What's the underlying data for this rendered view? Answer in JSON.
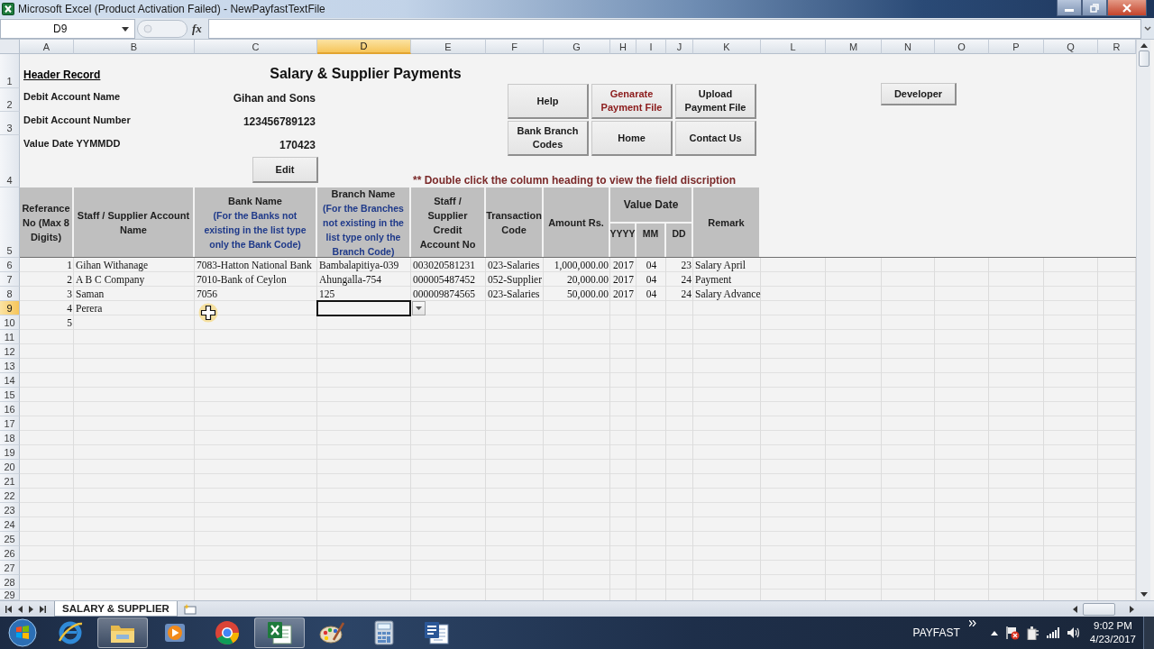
{
  "window": {
    "title": "Microsoft Excel (Product Activation Failed) - NewPayfastTextFile"
  },
  "formula_bar": {
    "name_box": "D9",
    "function_label": "fx"
  },
  "columns": [
    {
      "label": "A",
      "selected": false
    },
    {
      "label": "B",
      "selected": false
    },
    {
      "label": "C",
      "selected": false
    },
    {
      "label": "D",
      "selected": true
    },
    {
      "label": "E",
      "selected": false
    },
    {
      "label": "F",
      "selected": false
    },
    {
      "label": "G",
      "selected": false
    },
    {
      "label": "H",
      "selected": false
    },
    {
      "label": "I",
      "selected": false
    },
    {
      "label": "J",
      "selected": false
    },
    {
      "label": "K",
      "selected": false
    },
    {
      "label": "L",
      "selected": false
    },
    {
      "label": "M",
      "selected": false
    },
    {
      "label": "N",
      "selected": false
    },
    {
      "label": "O",
      "selected": false
    },
    {
      "label": "P",
      "selected": false
    },
    {
      "label": "Q",
      "selected": false
    },
    {
      "label": "R",
      "selected": false
    }
  ],
  "rows": [
    {
      "label": "1",
      "selected": false
    },
    {
      "label": "2",
      "selected": false
    },
    {
      "label": "3",
      "selected": false
    },
    {
      "label": "4",
      "selected": false
    },
    {
      "label": "5",
      "selected": false
    },
    {
      "label": "6",
      "selected": false
    },
    {
      "label": "7",
      "selected": false
    },
    {
      "label": "8",
      "selected": false
    },
    {
      "label": "9",
      "selected": true
    },
    {
      "label": "10",
      "selected": false
    },
    {
      "label": "11",
      "selected": false
    },
    {
      "label": "12",
      "selected": false
    },
    {
      "label": "13",
      "selected": false
    },
    {
      "label": "14",
      "selected": false
    },
    {
      "label": "15",
      "selected": false
    },
    {
      "label": "16",
      "selected": false
    },
    {
      "label": "17",
      "selected": false
    },
    {
      "label": "18",
      "selected": false
    },
    {
      "label": "19",
      "selected": false
    },
    {
      "label": "20",
      "selected": false
    },
    {
      "label": "21",
      "selected": false
    },
    {
      "label": "22",
      "selected": false
    },
    {
      "label": "23",
      "selected": false
    },
    {
      "label": "24",
      "selected": false
    },
    {
      "label": "25",
      "selected": false
    },
    {
      "label": "26",
      "selected": false
    },
    {
      "label": "27",
      "selected": false
    },
    {
      "label": "28",
      "selected": false
    },
    {
      "label": "29",
      "selected": false
    }
  ],
  "header_record": {
    "title": "Header Record",
    "fields": [
      {
        "label": "Debit Account Name",
        "value": "Gihan and Sons"
      },
      {
        "label": "Debit Account Number",
        "value": "123456789123"
      },
      {
        "label": "Value Date YYMMDD",
        "value": "170423"
      }
    ],
    "edit_button": "Edit"
  },
  "sheet_title": "Salary & Supplier Payments",
  "buttons": [
    {
      "label": "Help",
      "emphasis": false
    },
    {
      "label": "Genarate Payment File",
      "emphasis": true
    },
    {
      "label": "Upload Payment File",
      "emphasis": false
    },
    {
      "label": "Bank Branch Codes",
      "emphasis": false
    },
    {
      "label": "Home",
      "emphasis": false
    },
    {
      "label": "Contact Us",
      "emphasis": false
    }
  ],
  "developer_button": "Developer",
  "note": "** Double click the column heading to view the field discription",
  "table": {
    "columns": [
      {
        "title": "Referance No (Max 8 Digits)"
      },
      {
        "title": "Staff / Supplier Account Name"
      },
      {
        "title": "Bank Name",
        "note": "(For the Banks not existing in the list type only the Bank Code)"
      },
      {
        "title": "Branch Name",
        "note": "(For the Branches not existing in the list type only the Branch Code)"
      },
      {
        "title": "Staff / Supplier Credit Account No"
      },
      {
        "title": "Transaction Code"
      },
      {
        "title": "Amount Rs."
      },
      {
        "title": "Value Date",
        "subcolumns": [
          "YYYY",
          "MM",
          "DD"
        ]
      },
      {
        "title": "Remark"
      }
    ],
    "rows": [
      {
        "ref": "1",
        "name": "Gihan Withanage",
        "bank": "7083-Hatton National Bank",
        "branch": "Bambalapitiya-039",
        "account": "003020581231",
        "transaction": "023-Salaries",
        "amount": "1,000,000.00",
        "yyyy": "2017",
        "mm": "04",
        "dd": "23",
        "remark": "Salary April"
      },
      {
        "ref": "2",
        "name": "A B C Company",
        "bank": "7010-Bank of Ceylon",
        "branch": "Ahungalla-754",
        "account": "000005487452",
        "transaction": "052-Supplier",
        "amount": "20,000.00",
        "yyyy": "2017",
        "mm": "04",
        "dd": "24",
        "remark": "Payment"
      },
      {
        "ref": "3",
        "name": "Saman",
        "bank": "7056",
        "branch": "125",
        "account": "000009874565",
        "transaction": "023-Salaries",
        "amount": "50,000.00",
        "yyyy": "2017",
        "mm": "04",
        "dd": "24",
        "remark": "Salary Advance"
      },
      {
        "ref": "4",
        "name": "Perera"
      },
      {
        "ref": "5"
      }
    ]
  },
  "sheet_tabs": [
    {
      "label": "SALARY & SUPPLIER",
      "selected": true
    }
  ],
  "taskbar": {
    "apps": [
      {
        "kind": "ie",
        "active": false
      },
      {
        "kind": "folder",
        "active": true
      },
      {
        "kind": "media",
        "active": false
      },
      {
        "kind": "chrome",
        "active": false
      },
      {
        "kind": "excel",
        "active": true
      },
      {
        "kind": "paint",
        "active": false
      },
      {
        "kind": "calculator",
        "active": false
      },
      {
        "kind": "word",
        "active": false
      }
    ],
    "toolbar_label": "PAYFAST",
    "time": "9:02 PM",
    "date": "4/23/2017"
  }
}
